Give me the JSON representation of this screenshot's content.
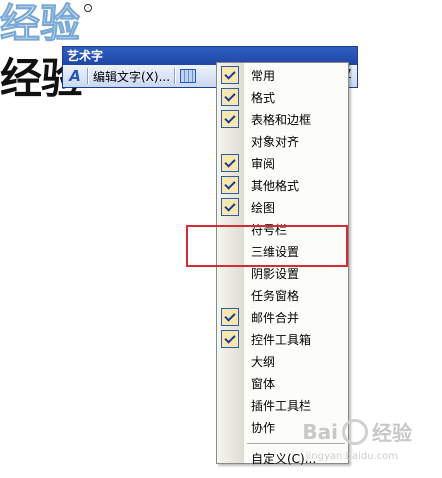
{
  "wordart": {
    "outline_text": "经验",
    "solid_text": "经验"
  },
  "toolbar": {
    "title": "艺术字",
    "edit_text_label": "编辑文字(X)...",
    "av_label": "AV"
  },
  "menu": {
    "items": [
      {
        "label": "常用",
        "checked": true
      },
      {
        "label": "格式",
        "checked": true
      },
      {
        "label": "表格和边框",
        "checked": true
      },
      {
        "label": "对象对齐",
        "checked": false
      },
      {
        "label": "审阅",
        "checked": true
      },
      {
        "label": "其他格式",
        "checked": true
      },
      {
        "label": "绘图",
        "checked": true
      },
      {
        "label": "符号栏",
        "checked": false
      },
      {
        "label": "三维设置",
        "checked": false
      },
      {
        "label": "阴影设置",
        "checked": false
      },
      {
        "label": "任务窗格",
        "checked": false
      },
      {
        "label": "邮件合并",
        "checked": true
      },
      {
        "label": "控件工具箱",
        "checked": true
      },
      {
        "label": "大纲",
        "checked": false
      },
      {
        "label": "窗体",
        "checked": false
      },
      {
        "label": "插件工具栏",
        "checked": false
      },
      {
        "label": "协作",
        "checked": false
      }
    ],
    "customize_label": "自定义(C)..."
  },
  "watermark": {
    "brand": "Bai",
    "brand_suffix": "经验",
    "url": "jingyan.baidu.com"
  },
  "colors": {
    "highlight": "#d42c34",
    "toolbar_title": "#2f5fc4",
    "check_bg": "#fbe7ad"
  }
}
